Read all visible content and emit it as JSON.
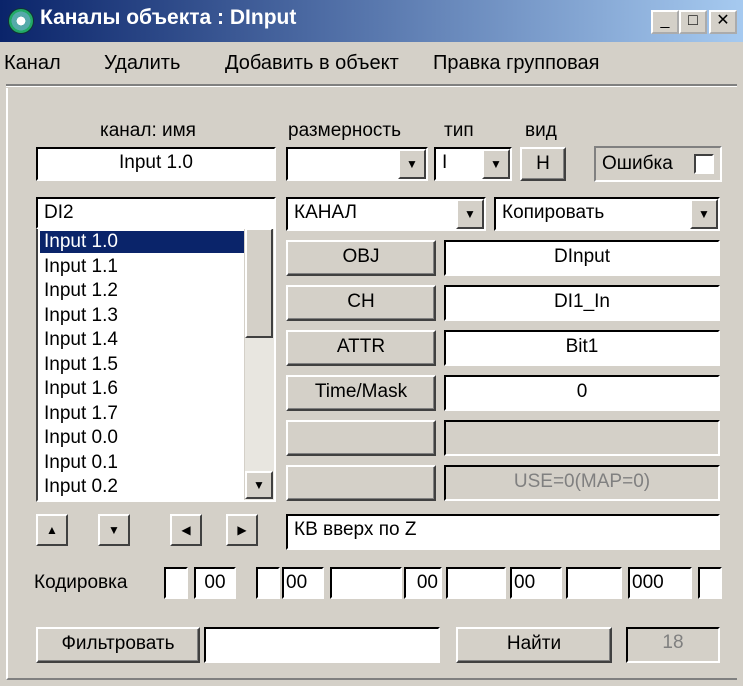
{
  "window": {
    "title": "Каналы объекта : DInput",
    "minimize": "_",
    "maximize": "□",
    "close": "✕"
  },
  "menu": [
    "Канал",
    "Удалить",
    "Добавить в объект",
    "Правка групповая"
  ],
  "header": {
    "name_label": "канал: имя",
    "dim_label": "размерность",
    "type_label": "тип",
    "view_label": "вид",
    "name_value": "Input 1.0",
    "dim_value": "",
    "type_value": "I",
    "view_button": "H",
    "error_label": "Ошибка",
    "error_checked": false
  },
  "channel_list": {
    "input_value": "DI2",
    "items": [
      "Input 1.0",
      "Input 1.1",
      "Input 1.2",
      "Input 1.3",
      "Input 1.4",
      "Input 1.5",
      "Input 1.6",
      "Input 1.7",
      "Input 0.0",
      "Input 0.1",
      "Input 0.2"
    ],
    "selected": "Input 1.0"
  },
  "selectors": {
    "mode": "КАНАЛ",
    "action": "Копировать"
  },
  "properties": [
    {
      "button": "OBJ",
      "value": "DInput",
      "enabled": true
    },
    {
      "button": "CH",
      "value": "DI1_In",
      "enabled": true
    },
    {
      "button": "ATTR",
      "value": "Bit1",
      "enabled": true
    },
    {
      "button": "Time/Mask",
      "value": "0",
      "enabled": true
    },
    {
      "button": "",
      "value": "",
      "enabled": false
    },
    {
      "button": "",
      "value": "USE=0(MAP=0)",
      "enabled": false
    }
  ],
  "comment_value": "КВ вверх по Z",
  "encoding": {
    "label": "Кодировка",
    "fields": [
      "",
      "00",
      "",
      "00",
      "",
      "00",
      "",
      "00",
      "",
      "000",
      ""
    ]
  },
  "footer": {
    "filter_button": "Фильтровать",
    "filter_value": "",
    "find_button": "Найти",
    "count": "18"
  },
  "icons": {
    "up": "▲",
    "down": "▼",
    "left": "◀",
    "right": "▶"
  }
}
